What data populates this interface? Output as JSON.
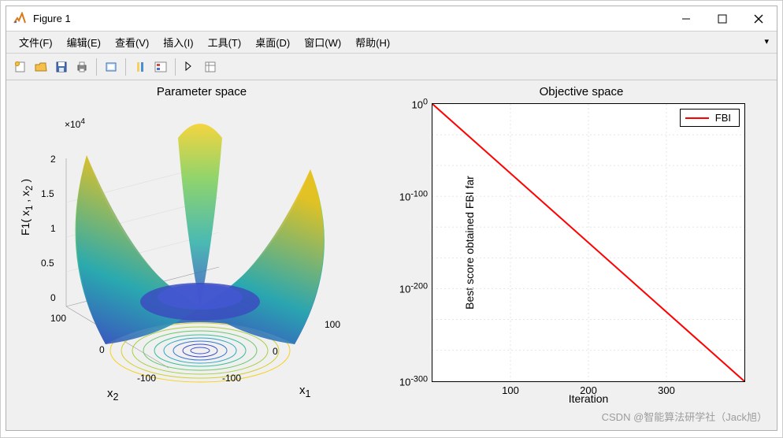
{
  "window": {
    "title": "Figure 1"
  },
  "menus": {
    "file": "文件(F)",
    "edit": "编辑(E)",
    "view": "查看(V)",
    "insert": "插入(I)",
    "tools": "工具(T)",
    "desktop": "桌面(D)",
    "window": "窗口(W)",
    "help": "帮助(H)"
  },
  "left_plot": {
    "title": "Parameter space",
    "multiplier": "×10",
    "multiplier_exp": "4",
    "zlabel_prefix": "F1( x",
    "zlabel_sub1": "1",
    "zlabel_mid": " , x",
    "zlabel_sub2": "2",
    "zlabel_suffix": " )",
    "xlabel_prefix": "x",
    "xlabel_sub": "1",
    "ylabel_prefix": "x",
    "ylabel_sub": "2",
    "zticks": [
      "0",
      "0.5",
      "1",
      "1.5",
      "2"
    ],
    "xticks": [
      "-100",
      "0",
      "100"
    ],
    "yticks": [
      "-100",
      "0",
      "100"
    ]
  },
  "right_plot": {
    "title": "Objective space",
    "xlabel": "Iteration",
    "ylabel": "Best score obtained FBI far",
    "legend": "FBI",
    "yticks": [
      {
        "base": "10",
        "exp": "0",
        "pos": 0
      },
      {
        "base": "10",
        "exp": "-100",
        "pos": 33.3
      },
      {
        "base": "10",
        "exp": "-200",
        "pos": 66.6
      },
      {
        "base": "10",
        "exp": "-300",
        "pos": 100
      }
    ],
    "xticks": [
      {
        "label": "100",
        "pos": 25
      },
      {
        "label": "200",
        "pos": 50
      },
      {
        "label": "300",
        "pos": 75
      }
    ]
  },
  "watermark": "CSDN @智能算法研学社（Jack旭）",
  "chart_data": [
    {
      "type": "surface",
      "title": "Parameter space",
      "xlabel": "x1",
      "ylabel": "x2",
      "zlabel": "F1(x1, x2)",
      "xlim": [
        -100,
        100
      ],
      "ylim": [
        -100,
        100
      ],
      "zlim": [
        0,
        20000
      ],
      "description": "3D surface plot of F1 = x1^2 + x2^2 (sphere-like function) with contour projection at z=0",
      "z_multiplier": 10000
    },
    {
      "type": "line",
      "title": "Objective space",
      "xlabel": "Iteration",
      "ylabel": "Best score obtained FBI far",
      "xlim": [
        0,
        400
      ],
      "ylim_log": [
        1e-300,
        1.0
      ],
      "yscale": "log",
      "series": [
        {
          "name": "FBI",
          "color": "#ff0000",
          "x": [
            0,
            50,
            100,
            150,
            200,
            250,
            300,
            350,
            400
          ],
          "y": [
            1.0,
            1e-37,
            1e-75,
            1e-112,
            1e-150,
            1e-187,
            1e-225,
            1e-262,
            1e-300
          ]
        }
      ]
    }
  ]
}
